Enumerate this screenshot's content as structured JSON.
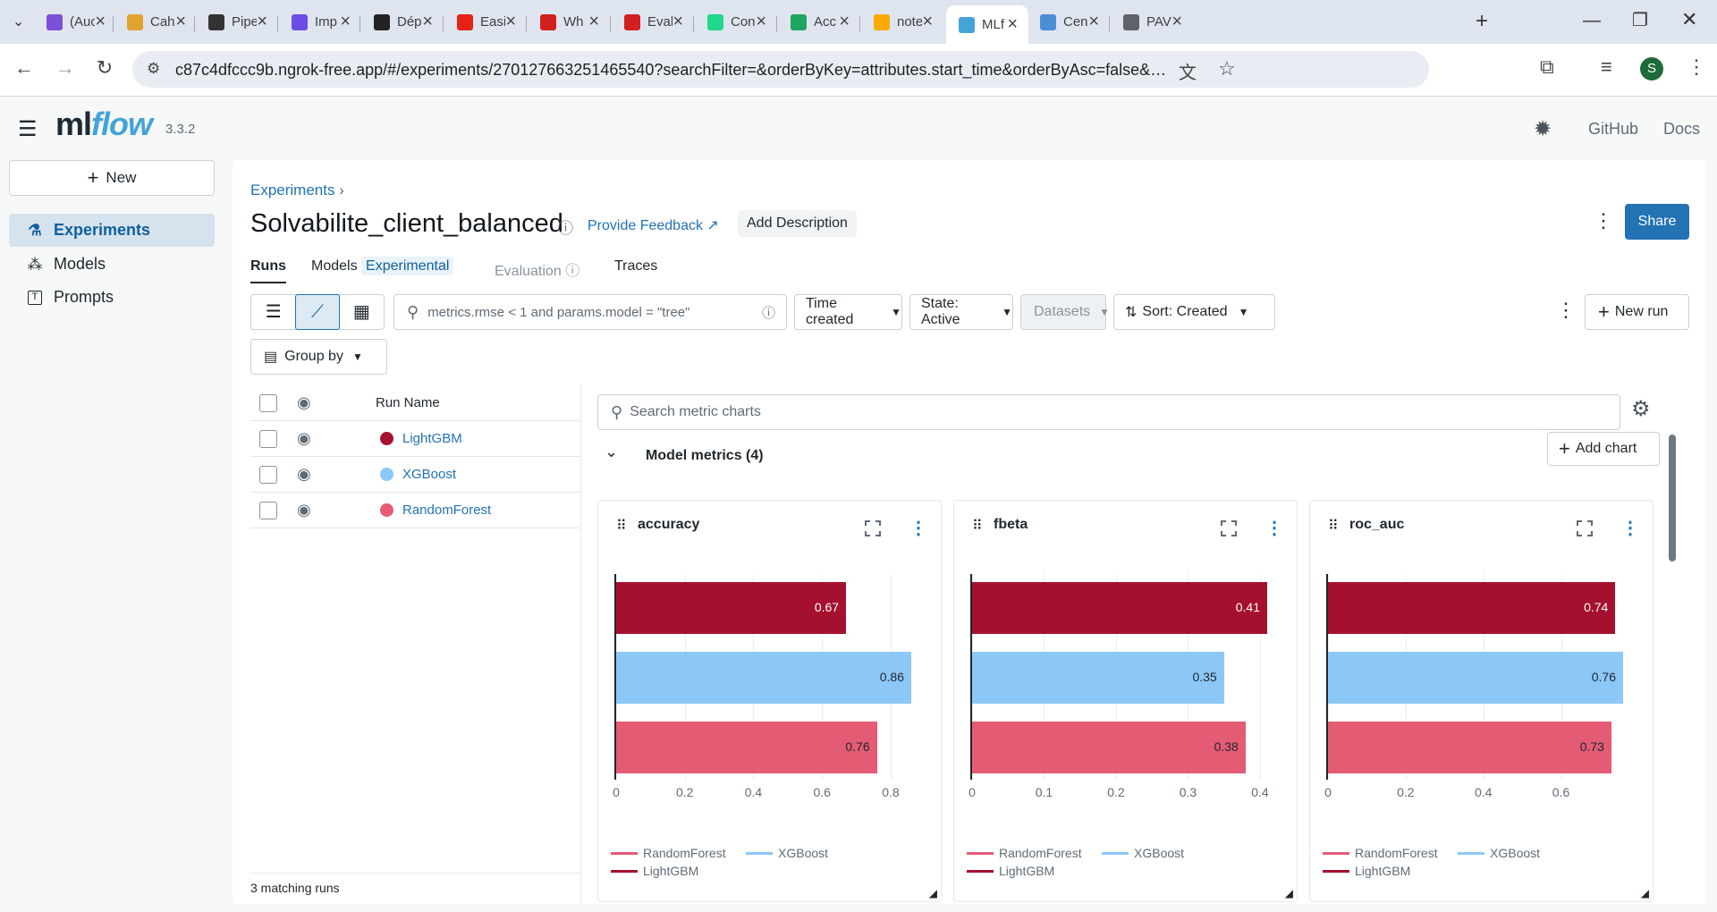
{
  "browser": {
    "tabs": [
      {
        "title": "(Auc",
        "icon": "mail-icon",
        "color": "#7b4fd6"
      },
      {
        "title": "Cah",
        "icon": "cah-icon",
        "color": "#e0a32e"
      },
      {
        "title": "Pipe",
        "icon": "openai-icon",
        "color": "#333333"
      },
      {
        "title": "Imp",
        "icon": "imp-icon",
        "color": "#6b4ce6"
      },
      {
        "title": "Dép",
        "icon": "notion-icon",
        "color": "#222222"
      },
      {
        "title": "Easi",
        "icon": "youtube-icon",
        "color": "#e62117"
      },
      {
        "title": "Wh",
        "icon": "chart-icon",
        "color": "#d31f1f"
      },
      {
        "title": "Eval",
        "icon": "chart-icon",
        "color": "#d31f1f"
      },
      {
        "title": "Con",
        "icon": "pycharm-icon",
        "color": "#21d789"
      },
      {
        "title": "Acc",
        "icon": "drive-icon",
        "color": "#1fa463"
      },
      {
        "title": "note",
        "icon": "colab-icon",
        "color": "#f9ab00"
      },
      {
        "title": "MLf",
        "icon": "mlflow-icon",
        "color": "#43a4d8"
      },
      {
        "title": "Cen",
        "icon": "cen-icon",
        "color": "#4a8fd6"
      },
      {
        "title": "PAV",
        "icon": "globe-icon",
        "color": "#5f6368"
      }
    ],
    "url": "c87c4dfccc9b.ngrok-free.app/#/experiments/270127663251465540?searchFilter=&orderByKey=attributes.start_time&orderByAsc=false&startTime=ALL&lifecycleFilter=Active&mod...",
    "profile_letter": "S"
  },
  "app": {
    "logo_main": "ml",
    "logo_italic": "flow",
    "version": "3.3.2",
    "github": "GitHub",
    "docs": "Docs"
  },
  "sidebar": {
    "new_label": "New",
    "items": [
      {
        "label": "Experiments"
      },
      {
        "label": "Models"
      },
      {
        "label": "Prompts"
      }
    ]
  },
  "experiment": {
    "breadcrumb": "Experiments",
    "title": "Solvabilite_client_balanced",
    "feedback": "Provide Feedback",
    "add_description": "Add Description",
    "share": "Share",
    "tabs": {
      "runs": "Runs",
      "models": "Models",
      "experimental": "Experimental",
      "evaluation": "Evaluation",
      "traces": "Traces"
    }
  },
  "toolbar": {
    "search_placeholder": "metrics.rmse < 1 and params.model = \"tree\"",
    "time_created": "Time created",
    "state": "State: Active",
    "datasets": "Datasets",
    "sort": "Sort: Created",
    "new_run": "New run",
    "group_by": "Group by"
  },
  "runs": {
    "header": "Run Name",
    "rows": [
      {
        "name": "LightGBM",
        "color": "#a5102e"
      },
      {
        "name": "XGBoost",
        "color": "#8cc8f7"
      },
      {
        "name": "RandomForest",
        "color": "#e45b74"
      }
    ],
    "footer": "3 matching runs"
  },
  "charts_panel": {
    "search_placeholder": "Search metric charts",
    "section_title": "Model metrics (4)",
    "add_chart": "Add chart"
  },
  "chart_data": [
    {
      "type": "bar",
      "title": "accuracy",
      "categories": [
        "LightGBM",
        "XGBoost",
        "RandomForest"
      ],
      "values": [
        0.67,
        0.86,
        0.76
      ],
      "xlim": [
        0,
        0.86
      ],
      "ticks": [
        "0",
        "0.2",
        "0.4",
        "0.6",
        "0.8"
      ],
      "tick_values": [
        0,
        0.2,
        0.4,
        0.6,
        0.8
      ],
      "colors": [
        "#a5102e",
        "#8cc8f7",
        "#e45b74"
      ],
      "legend": [
        "RandomForest",
        "XGBoost",
        "LightGBM"
      ]
    },
    {
      "type": "bar",
      "title": "fbeta",
      "categories": [
        "LightGBM",
        "XGBoost",
        "RandomForest"
      ],
      "values": [
        0.41,
        0.35,
        0.38
      ],
      "xlim": [
        0,
        0.41
      ],
      "ticks": [
        "0",
        "0.1",
        "0.2",
        "0.3",
        "0.4"
      ],
      "tick_values": [
        0,
        0.1,
        0.2,
        0.3,
        0.4
      ],
      "colors": [
        "#a5102e",
        "#8cc8f7",
        "#e45b74"
      ],
      "legend": [
        "RandomForest",
        "XGBoost",
        "LightGBM"
      ]
    },
    {
      "type": "bar",
      "title": "roc_auc",
      "categories": [
        "LightGBM",
        "XGBoost",
        "RandomForest"
      ],
      "values": [
        0.74,
        0.76,
        0.73
      ],
      "xlim": [
        0,
        0.76
      ],
      "ticks": [
        "0",
        "0.2",
        "0.4",
        "0.6"
      ],
      "tick_values": [
        0,
        0.2,
        0.4,
        0.6
      ],
      "colors": [
        "#a5102e",
        "#8cc8f7",
        "#e45b74"
      ],
      "legend": [
        "RandomForest",
        "XGBoost",
        "LightGBM"
      ]
    }
  ]
}
